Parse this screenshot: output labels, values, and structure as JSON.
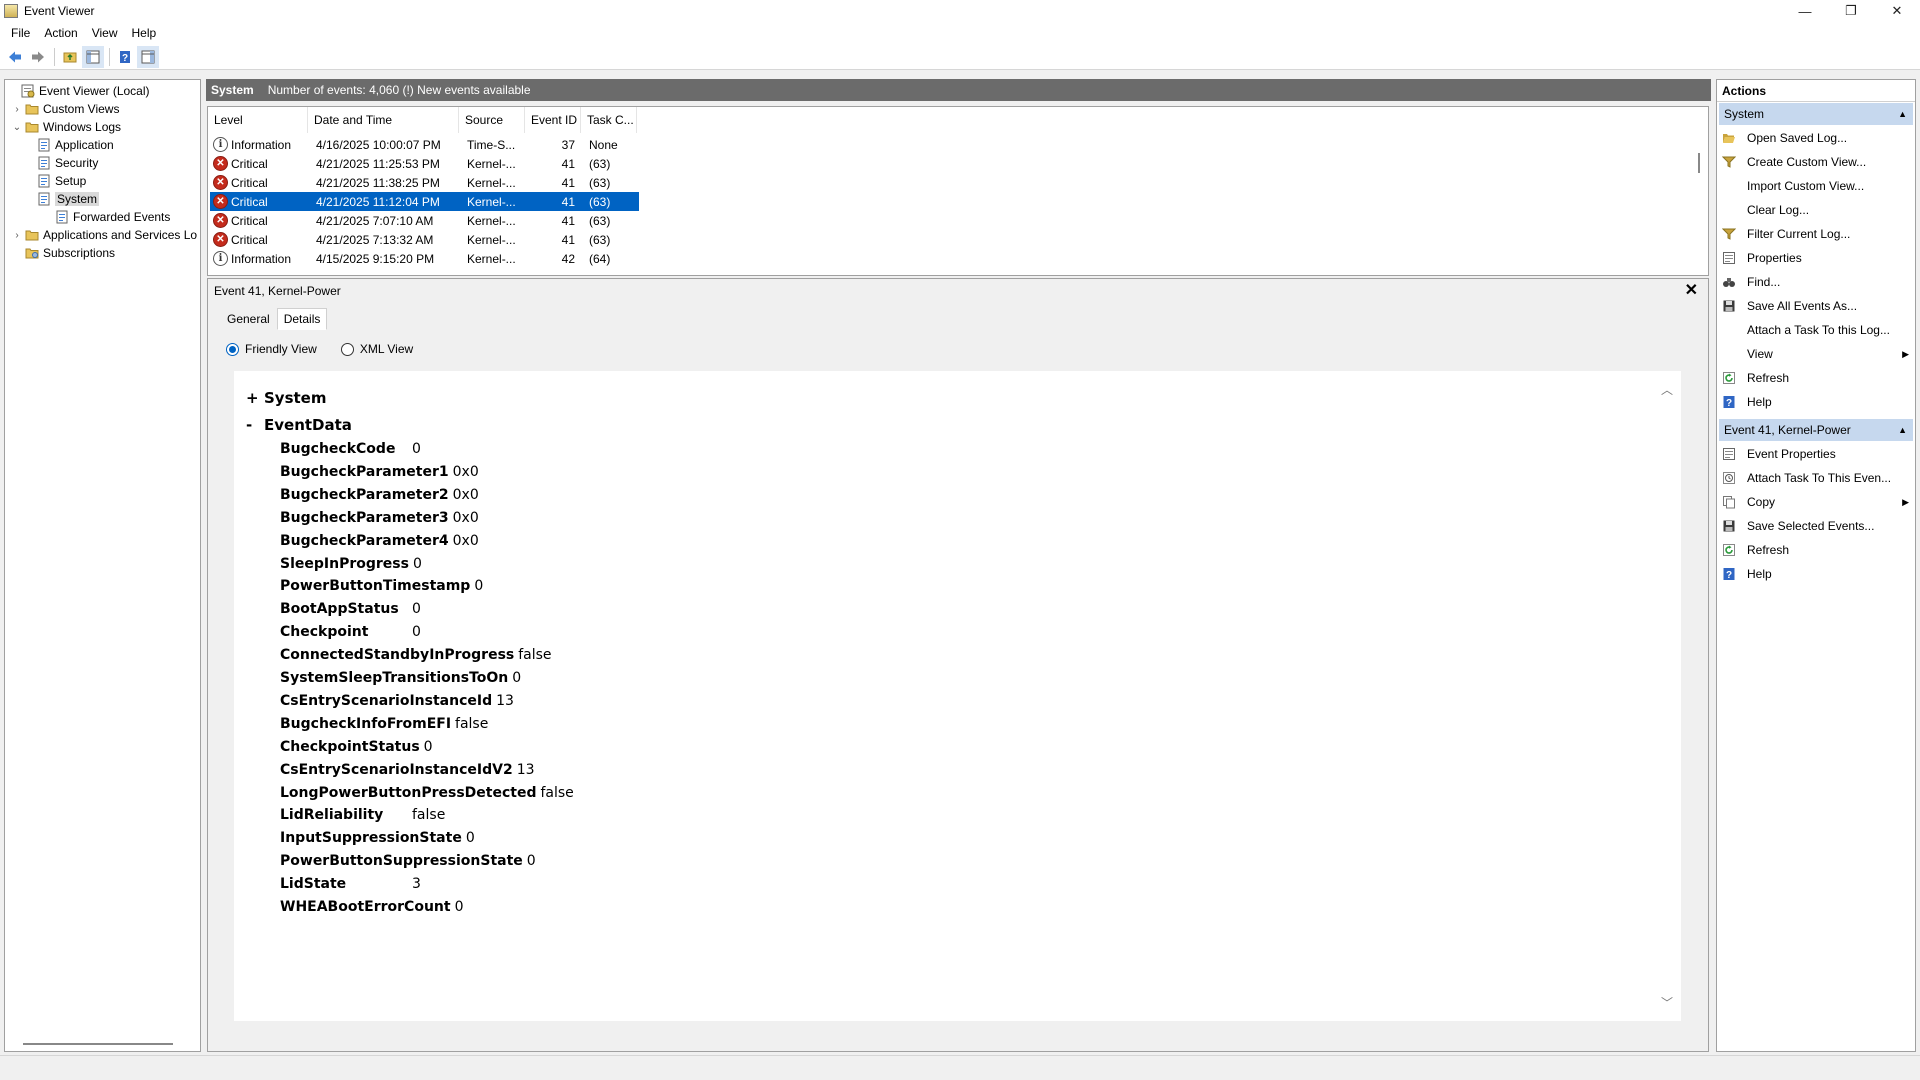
{
  "window": {
    "title": "Event Viewer",
    "controls": [
      "—",
      "❐",
      "✕"
    ]
  },
  "menu": [
    "File",
    "Action",
    "View",
    "Help"
  ],
  "tree": [
    {
      "label": "Event Viewer (Local)",
      "indent": 0,
      "expander": "",
      "icon": "event-viewer-icon"
    },
    {
      "label": "Custom Views",
      "indent": 1,
      "expander": "›",
      "icon": "folder-icon"
    },
    {
      "label": "Windows Logs",
      "indent": 1,
      "expander": "⌄",
      "icon": "folder-icon"
    },
    {
      "label": "Application",
      "indent": 2,
      "expander": "",
      "icon": "log-icon"
    },
    {
      "label": "Security",
      "indent": 2,
      "expander": "",
      "icon": "log-icon"
    },
    {
      "label": "Setup",
      "indent": 2,
      "expander": "",
      "icon": "log-icon"
    },
    {
      "label": "System",
      "indent": 2,
      "expander": "",
      "icon": "log-icon",
      "selected": true
    },
    {
      "label": "Forwarded Events",
      "indent": 2,
      "expander": "",
      "icon": "log-icon"
    },
    {
      "label": "Applications and Services Lo",
      "indent": 1,
      "expander": "›",
      "icon": "folder-icon"
    },
    {
      "label": "Subscriptions",
      "indent": 1,
      "expander": "",
      "icon": "subscriptions-icon"
    }
  ],
  "center": {
    "log_name": "System",
    "summary": "Number of events: 4,060 (!) New events available"
  },
  "grid": {
    "columns": [
      "Level",
      "Date and Time",
      "Source",
      "Event ID",
      "Task C..."
    ],
    "rows": [
      {
        "level": "Information",
        "kind": "info",
        "datetime": "4/16/2025 10:00:07 PM",
        "source": "Time-S...",
        "event_id": "37",
        "task": "None"
      },
      {
        "level": "Critical",
        "kind": "crit",
        "datetime": "4/21/2025 11:25:53 PM",
        "source": "Kernel-...",
        "event_id": "41",
        "task": "(63)"
      },
      {
        "level": "Critical",
        "kind": "crit",
        "datetime": "4/21/2025 11:38:25 PM",
        "source": "Kernel-...",
        "event_id": "41",
        "task": "(63)"
      },
      {
        "level": "Critical",
        "kind": "crit",
        "datetime": "4/21/2025 11:12:04 PM",
        "source": "Kernel-...",
        "event_id": "41",
        "task": "(63)",
        "selected": true
      },
      {
        "level": "Critical",
        "kind": "crit",
        "datetime": "4/21/2025 7:07:10 AM",
        "source": "Kernel-...",
        "event_id": "41",
        "task": "(63)"
      },
      {
        "level": "Critical",
        "kind": "crit",
        "datetime": "4/21/2025 7:13:32 AM",
        "source": "Kernel-...",
        "event_id": "41",
        "task": "(63)"
      },
      {
        "level": "Information",
        "kind": "info",
        "datetime": "4/15/2025 9:15:20 PM",
        "source": "Kernel-...",
        "event_id": "42",
        "task": "(64)"
      }
    ]
  },
  "detail": {
    "title": "Event 41, Kernel-Power",
    "close": "✕",
    "tabs": [
      "General",
      "Details"
    ],
    "active_tab": "Details",
    "view_options": [
      "Friendly View",
      "XML View"
    ],
    "selected_view": "Friendly View",
    "system_section": {
      "sign": "+",
      "label": "System"
    },
    "eventdata_section": {
      "sign": "-",
      "label": "EventData"
    },
    "event_data": [
      {
        "key": "BugcheckCode",
        "value": "0"
      },
      {
        "key": "BugcheckParameter1",
        "value": "0x0"
      },
      {
        "key": "BugcheckParameter2",
        "value": "0x0"
      },
      {
        "key": "BugcheckParameter3",
        "value": "0x0"
      },
      {
        "key": "BugcheckParameter4",
        "value": "0x0"
      },
      {
        "key": "SleepInProgress",
        "value": "0"
      },
      {
        "key": "PowerButtonTimestamp",
        "value": "0"
      },
      {
        "key": "BootAppStatus",
        "value": "0"
      },
      {
        "key": "Checkpoint",
        "value": "0"
      },
      {
        "key": "ConnectedStandbyInProgress",
        "value": "false"
      },
      {
        "key": "SystemSleepTransitionsToOn",
        "value": "0"
      },
      {
        "key": "CsEntryScenarioInstanceId",
        "value": "13"
      },
      {
        "key": "BugcheckInfoFromEFI",
        "value": "false"
      },
      {
        "key": "CheckpointStatus",
        "value": "0"
      },
      {
        "key": "CsEntryScenarioInstanceIdV2",
        "value": "13"
      },
      {
        "key": "LongPowerButtonPressDetected",
        "value": "false"
      },
      {
        "key": "LidReliability",
        "value": "false"
      },
      {
        "key": "InputSuppressionState",
        "value": "0"
      },
      {
        "key": "PowerButtonSuppressionState",
        "value": "0"
      },
      {
        "key": "LidState",
        "value": "3"
      },
      {
        "key": "WHEABootErrorCount",
        "value": "0"
      }
    ]
  },
  "actions": {
    "title": "Actions",
    "sections": [
      {
        "label": "System",
        "items": [
          {
            "label": "Open Saved Log...",
            "icon": "open-folder-icon"
          },
          {
            "label": "Create Custom View...",
            "icon": "filter-icon"
          },
          {
            "label": "Import Custom View...",
            "icon": ""
          },
          {
            "label": "Clear Log...",
            "icon": ""
          },
          {
            "label": "Filter Current Log...",
            "icon": "filter-icon"
          },
          {
            "label": "Properties",
            "icon": "properties-icon"
          },
          {
            "label": "Find...",
            "icon": "binoculars-icon"
          },
          {
            "label": "Save All Events As...",
            "icon": "save-icon"
          },
          {
            "label": "Attach a Task To this Log...",
            "icon": ""
          },
          {
            "label": "View",
            "icon": "",
            "submenu": true
          },
          {
            "label": "Refresh",
            "icon": "refresh-icon"
          },
          {
            "label": "Help",
            "icon": "help-icon"
          }
        ]
      },
      {
        "label": "Event 41, Kernel-Power",
        "items": [
          {
            "label": "Event Properties",
            "icon": "properties-icon"
          },
          {
            "label": "Attach Task To This Even...",
            "icon": "task-icon"
          },
          {
            "label": "Copy",
            "icon": "copy-icon",
            "submenu": true
          },
          {
            "label": "Save Selected Events...",
            "icon": "save-icon"
          },
          {
            "label": "Refresh",
            "icon": "refresh-icon"
          },
          {
            "label": "Help",
            "icon": "help-icon"
          }
        ]
      }
    ]
  },
  "colors": {
    "selection": "#0063c3",
    "critical": "#c42b1c",
    "action_header": "#c6d8ee",
    "log_header": "#6b6b6b"
  }
}
